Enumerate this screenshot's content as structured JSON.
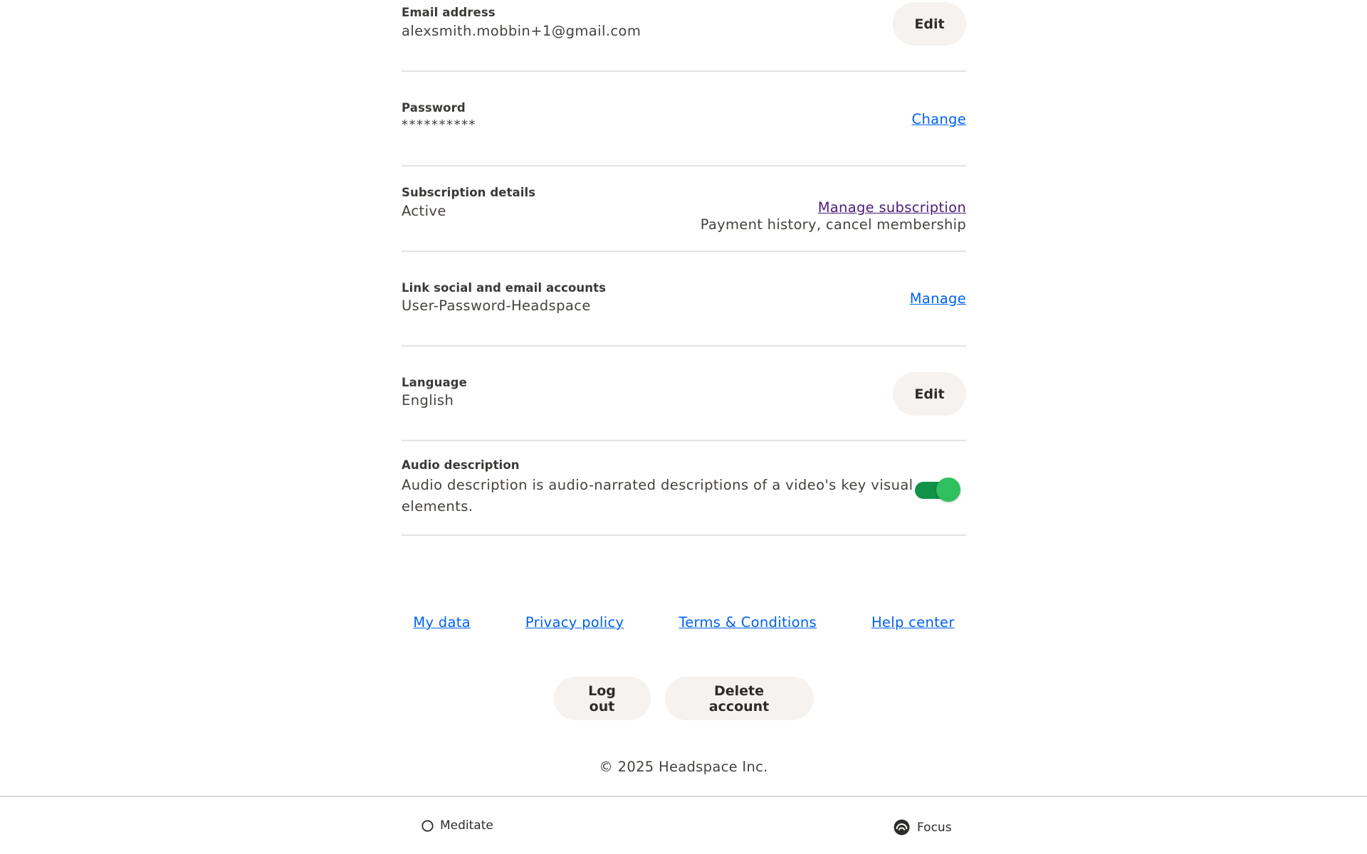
{
  "settings": {
    "email": {
      "label": "Email address",
      "value": "alexsmith.mobbin+1@gmail.com",
      "action": "Edit"
    },
    "password": {
      "label": "Password",
      "value": "**********",
      "action": "Change"
    },
    "subscription": {
      "label": "Subscription details",
      "value": "Active",
      "action": "Manage subscription",
      "note": "Payment history, cancel membership"
    },
    "linked_accounts": {
      "label": "Link social and email accounts",
      "value": "User-Password-Headspace",
      "action": "Manage"
    },
    "language": {
      "label": "Language",
      "value": "English",
      "action": "Edit"
    },
    "audio_description": {
      "label": "Audio description",
      "line1": "Audio description is audio-narrated descriptions of a video's key visual",
      "line2": "elements.",
      "enabled": true
    }
  },
  "footer_links": {
    "my_data": "My data",
    "privacy_policy": "Privacy policy",
    "terms": "Terms & Conditions",
    "help_center": "Help center"
  },
  "account_actions": {
    "log_out": "Log out",
    "delete_account": "Delete account"
  },
  "copyright": "© 2025 Headspace Inc.",
  "bottom_nav": {
    "meditate": {
      "label": "Meditate",
      "icon": "circle-outline-icon"
    },
    "focus": {
      "label": "Focus",
      "icon": "focus-icon"
    }
  },
  "colors": {
    "link": "#0061ef",
    "visited_link": "#4b1d7a",
    "button_bg": "#f5f2ef",
    "toggle_on": "#2fc05f",
    "divider": "#e6e4e1"
  }
}
